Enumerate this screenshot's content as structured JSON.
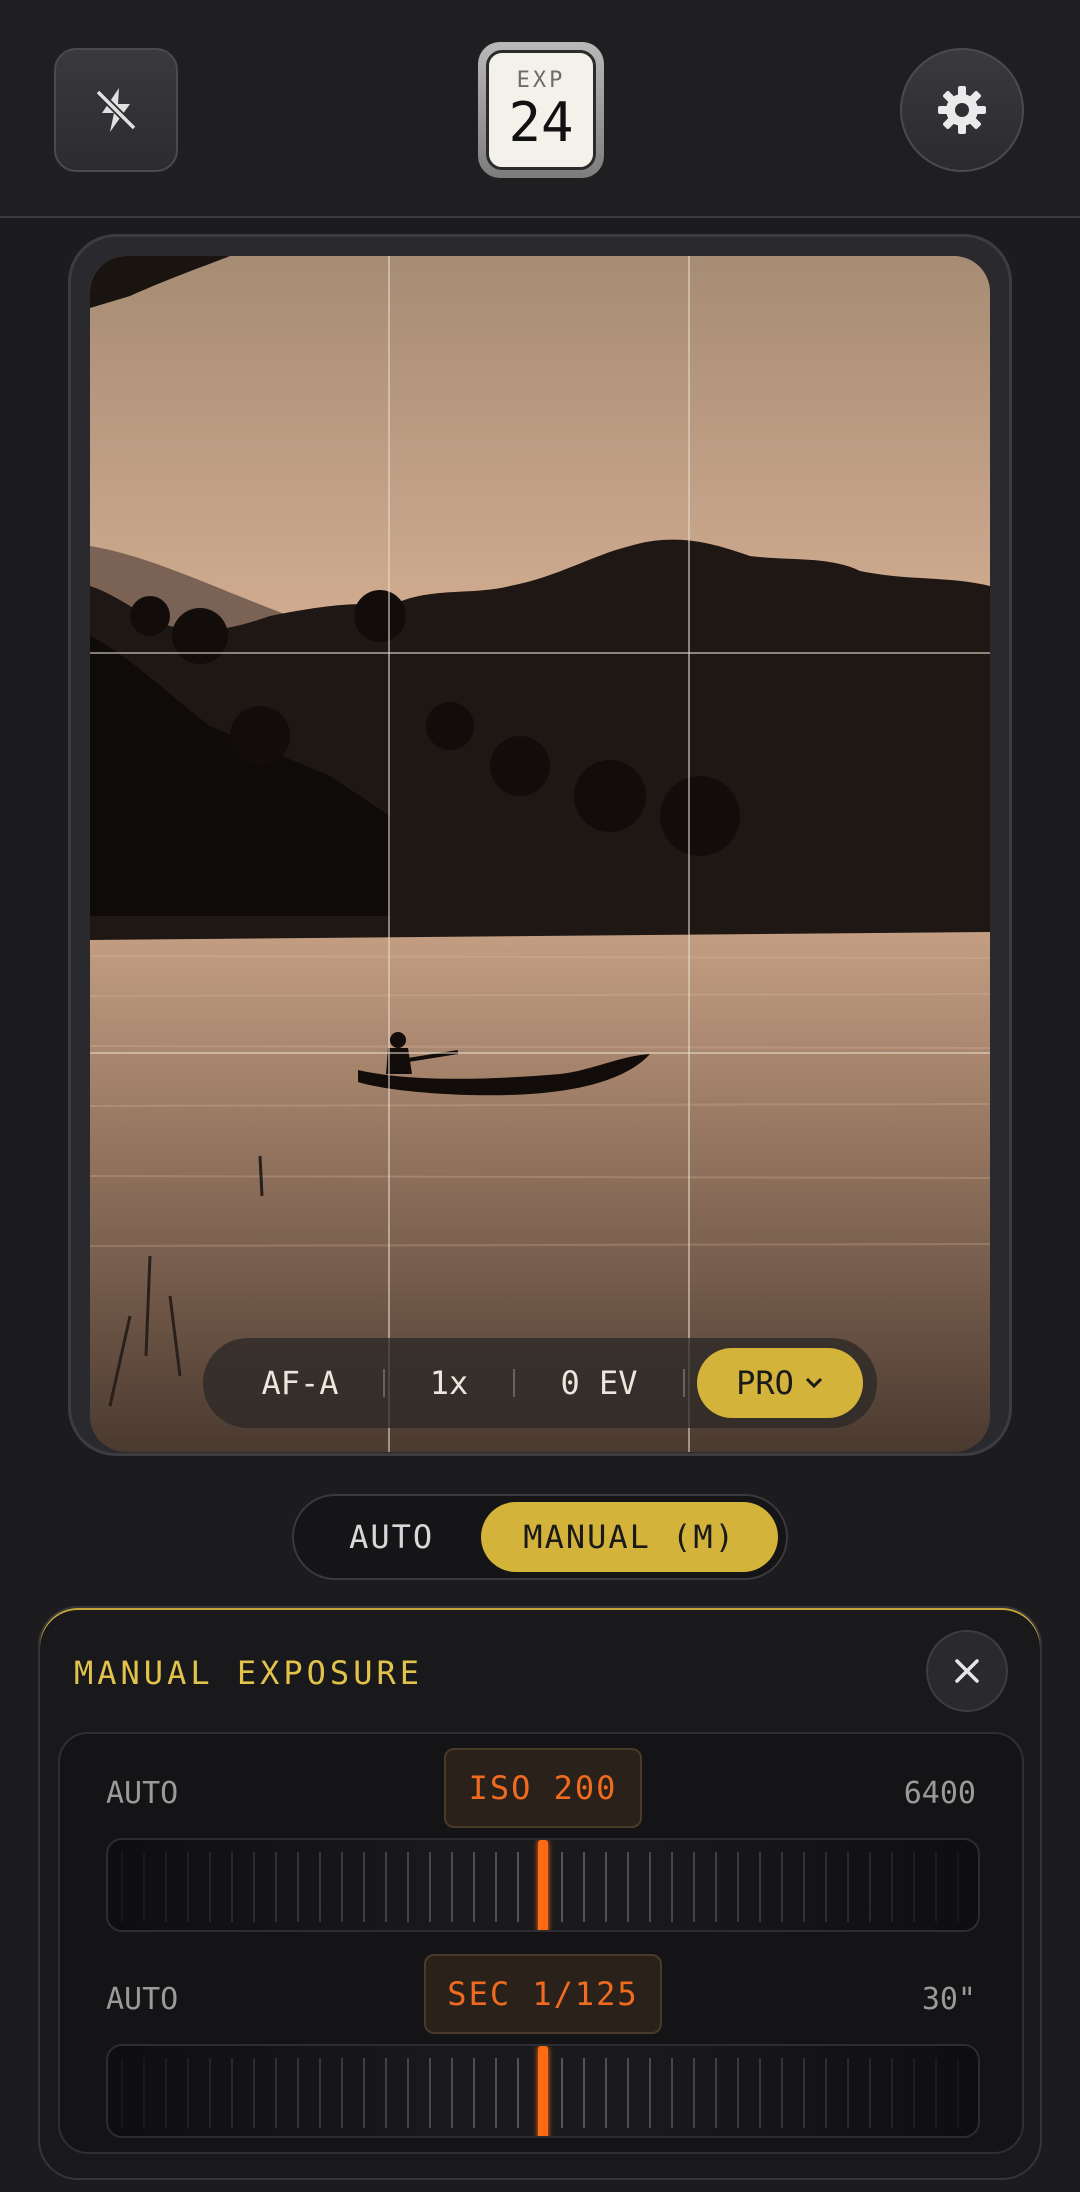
{
  "top_bar": {
    "flash_icon": "flash-off-icon",
    "exposure_counter": {
      "label": "EXP",
      "value": "24"
    },
    "settings_icon": "gear-icon"
  },
  "viewfinder": {
    "grid": "rule-of-thirds",
    "scene": "sepia lakeside sunset with hills, trees and a person in a canoe",
    "quick_settings": {
      "focus_mode": "AF-A",
      "zoom": "1x",
      "exposure_compensation": "0 EV",
      "pro_label": "PRO",
      "pro_icon": "chevron-down-icon"
    }
  },
  "mode_toggle": {
    "auto_label": "AUTO",
    "manual_label": "MANUAL (M)",
    "selected": "manual"
  },
  "manual_panel": {
    "title": "MANUAL EXPOSURE",
    "close_icon": "close-icon",
    "iso": {
      "min_label": "AUTO",
      "value_label": "ISO 200",
      "max_label": "6400"
    },
    "shutter": {
      "min_label": "AUTO",
      "value_label": "SEC 1/125",
      "max_label": "30\""
    }
  },
  "colors": {
    "accent_gold": "#d4b33a",
    "accent_orange": "#ff6a14",
    "background": "#1c1c1f"
  }
}
